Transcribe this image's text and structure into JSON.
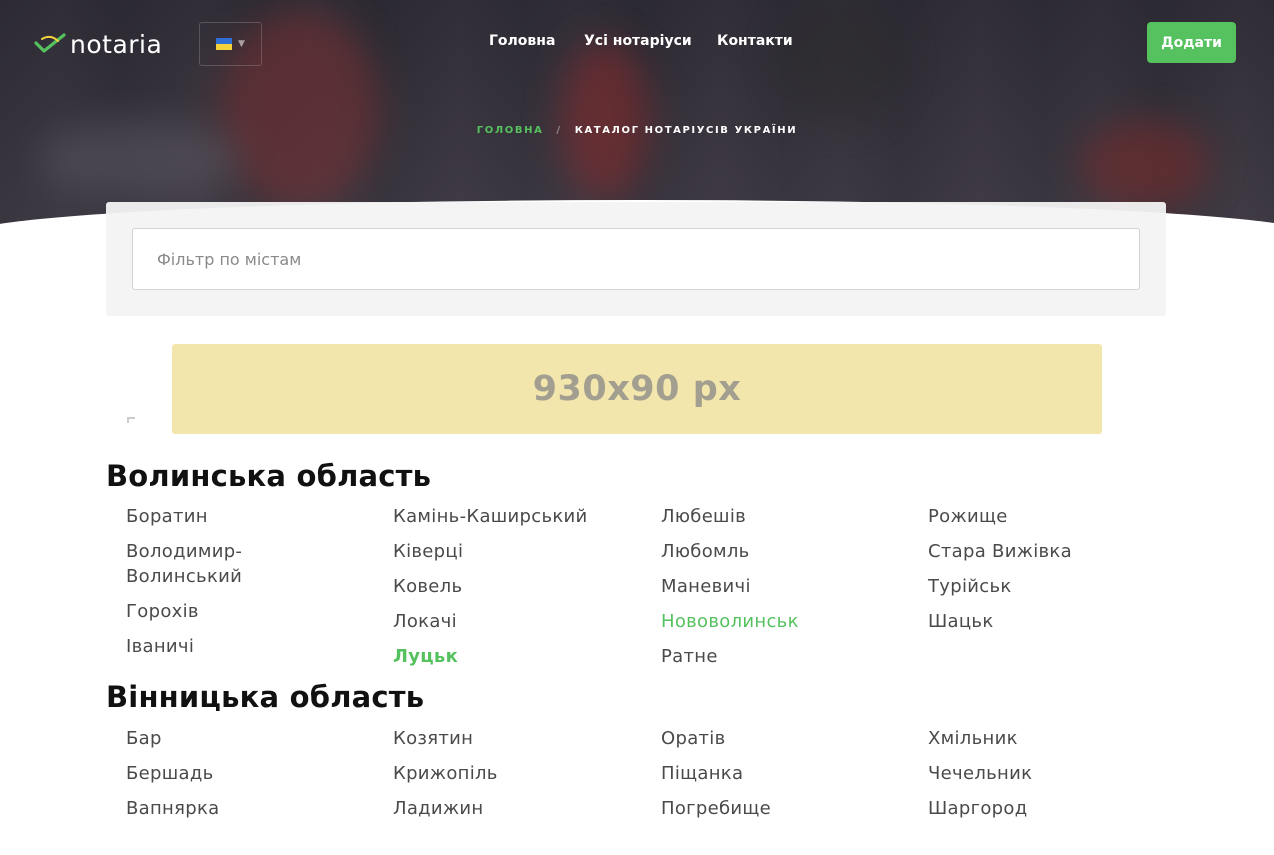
{
  "header": {
    "logo_text": "notaria",
    "language": {
      "flag": "ukraine-flag",
      "flag_colors": [
        "#2f6fd6",
        "#f3d23a"
      ]
    },
    "nav": [
      {
        "label": "Головна"
      },
      {
        "label": "Усі нотаріуси"
      },
      {
        "label": "Контакти"
      }
    ],
    "add_button": "Додати"
  },
  "breadcrumb": {
    "home": "Головна",
    "separator": "/",
    "current": "Каталог нотаріусів України"
  },
  "filter": {
    "placeholder": "Фільтр по містам",
    "value": ""
  },
  "ad_banner": {
    "text": "930x90 px"
  },
  "colors": {
    "accent": "#55c15f",
    "ad_background": "#f3e6ac"
  },
  "regions": [
    {
      "title": "Волинська область",
      "columns": [
        [
          {
            "name": "Боратин"
          },
          {
            "name": "Володимир-Волинський"
          },
          {
            "name": "Горохів"
          },
          {
            "name": "Іваничі"
          }
        ],
        [
          {
            "name": "Камінь-Каширський"
          },
          {
            "name": "Ківерці"
          },
          {
            "name": "Ковель"
          },
          {
            "name": "Локачі"
          },
          {
            "name": "Луцьк",
            "state": "active"
          }
        ],
        [
          {
            "name": "Любешів"
          },
          {
            "name": "Любомль"
          },
          {
            "name": "Маневичі"
          },
          {
            "name": "Нововолинськ",
            "state": "hover"
          },
          {
            "name": "Ратне"
          }
        ],
        [
          {
            "name": "Рожище"
          },
          {
            "name": "Стара Вижівка"
          },
          {
            "name": "Турійськ"
          },
          {
            "name": "Шацьк"
          }
        ]
      ]
    },
    {
      "title": "Вінницька область",
      "columns": [
        [
          {
            "name": "Бар"
          },
          {
            "name": "Бершадь"
          },
          {
            "name": "Вапнярка"
          }
        ],
        [
          {
            "name": "Козятин"
          },
          {
            "name": "Крижопіль"
          },
          {
            "name": "Ладижин"
          }
        ],
        [
          {
            "name": "Оратів"
          },
          {
            "name": "Піщанка"
          },
          {
            "name": "Погребище"
          }
        ],
        [
          {
            "name": "Хмільник"
          },
          {
            "name": "Чечельник"
          },
          {
            "name": "Шаргород"
          }
        ]
      ]
    }
  ]
}
